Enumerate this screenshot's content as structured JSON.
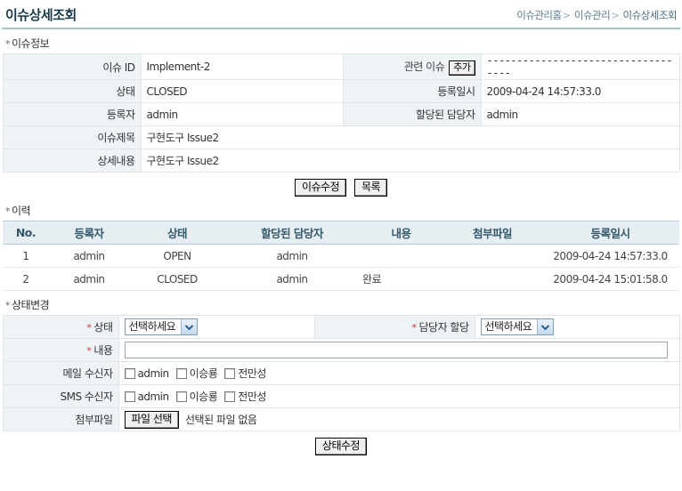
{
  "header": {
    "title": "이슈상세조회",
    "breadcrumb": [
      "이슈관리홈",
      "이슈관리",
      "이슈상세조회"
    ],
    "separator": ">"
  },
  "sections": {
    "info_title": "이슈정보",
    "history_title": "이력",
    "change_title": "상태변경",
    "star": "*"
  },
  "info": {
    "issue_id_label": "이슈 ID",
    "issue_id_value": "Implement-2",
    "related_issue_label": "관련 이슈",
    "related_issue_add_button": "추가",
    "related_issue_value": "-----------------------------------",
    "state_label": "상태",
    "state_value": "CLOSED",
    "reg_date_label": "등록일시",
    "reg_date_value": "2009-04-24 14:57:33.0",
    "writer_label": "등록자",
    "writer_value": "admin",
    "assignee_label": "할당된 담당자",
    "assignee_value": "admin",
    "subject_label": "이슈제목",
    "subject_value": "구현도구 Issue2",
    "detail_label": "상세내용",
    "detail_value": "구현도구 Issue2"
  },
  "info_buttons": {
    "edit": "이슈수정",
    "list": "목록"
  },
  "history": {
    "columns": [
      "No.",
      "등록자",
      "상태",
      "할당된 담당자",
      "내용",
      "첨부파일",
      "등록일시"
    ],
    "rows": [
      {
        "no": "1",
        "writer": "admin",
        "state": "OPEN",
        "assignee": "admin",
        "content": "",
        "file": "",
        "date": "2009-04-24 14:57:33.0"
      },
      {
        "no": "2",
        "writer": "admin",
        "state": "CLOSED",
        "assignee": "admin",
        "content": "완료",
        "file": "",
        "date": "2009-04-24 15:01:58.0"
      }
    ]
  },
  "change": {
    "state_label": "상태",
    "state_select_value": "선택하세요",
    "assign_label": "담당자 할당",
    "assign_select_value": "선택하세요",
    "content_label": "내용",
    "content_input_value": "",
    "mail_label": "메일 수신자",
    "sms_label": "SMS 수신자",
    "recipients": [
      "admin",
      "이승룡",
      "전만성"
    ],
    "file_label": "첨부파일",
    "file_button": "파일 선택",
    "file_status": "선택된 파일 없음",
    "submit_button": "상태수정"
  },
  "colors": {
    "title": "#1b3b4b",
    "rule": "#9fc8c4",
    "label_bg": "#eef3f6",
    "table_header_bg": "#e7eef2",
    "table_header_text": "#34596b",
    "required_star": "#cc3333",
    "breadcrumb": "#5b7c8c"
  }
}
